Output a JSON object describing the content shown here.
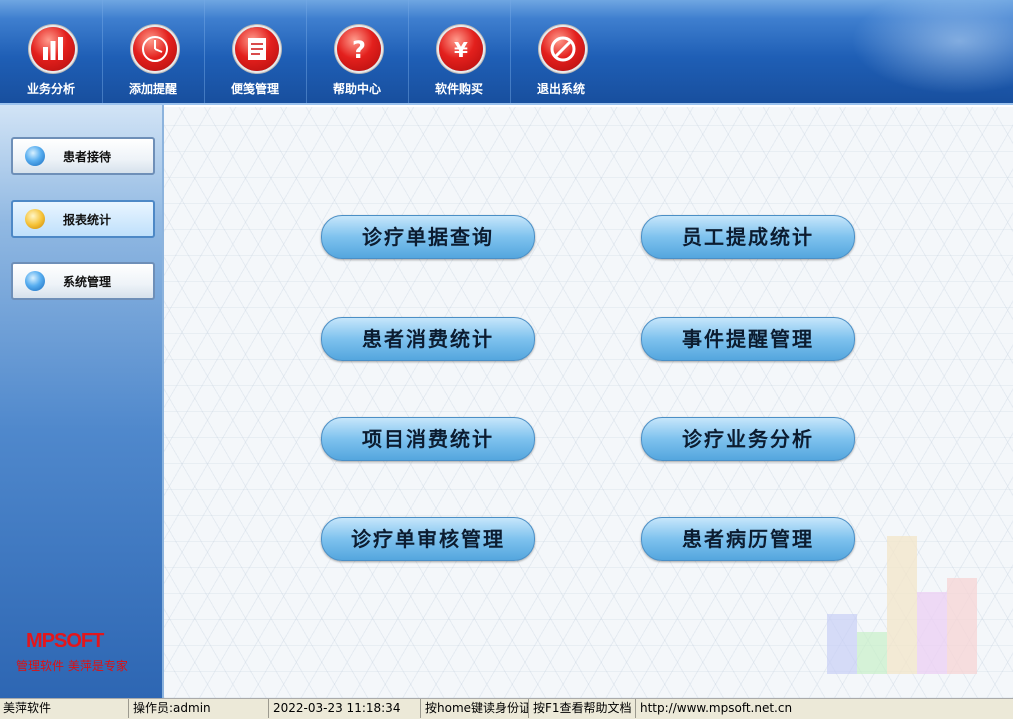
{
  "toolbar": {
    "buttons": [
      {
        "label": "业务分析",
        "icon": "bar-chart-icon"
      },
      {
        "label": "添加提醒",
        "icon": "clock-icon"
      },
      {
        "label": "便笺管理",
        "icon": "note-icon"
      },
      {
        "label": "帮助中心",
        "icon": "question-icon"
      },
      {
        "label": "软件购买",
        "icon": "yen-icon"
      },
      {
        "label": "退出系统",
        "icon": "forbidden-icon"
      }
    ]
  },
  "sidebar": {
    "items": [
      {
        "label": "患者接待",
        "active": false
      },
      {
        "label": "报表统计",
        "active": true
      },
      {
        "label": "系统管理",
        "active": false
      }
    ],
    "logo": "MPSOFT",
    "slogan": "管理软件 美萍是专家"
  },
  "main": {
    "buttons": [
      {
        "label": "诊疗单据查询"
      },
      {
        "label": "员工提成统计"
      },
      {
        "label": "患者消费统计"
      },
      {
        "label": "事件提醒管理"
      },
      {
        "label": "项目消费统计"
      },
      {
        "label": "诊疗业务分析"
      },
      {
        "label": "诊疗单审核管理"
      },
      {
        "label": "患者病历管理"
      }
    ]
  },
  "status": {
    "app": "美萍软件",
    "operator": "操作员:admin",
    "datetime": "2022-03-23 11:18:34",
    "hint_home": "按home键读身份证",
    "hint_f1": "按F1查看帮助文档",
    "url": "http://www.mpsoft.net.cn"
  },
  "colors": {
    "accent": "#1f5fb6",
    "button_red": "#e3201d",
    "func_button": "#7ec2ee"
  }
}
